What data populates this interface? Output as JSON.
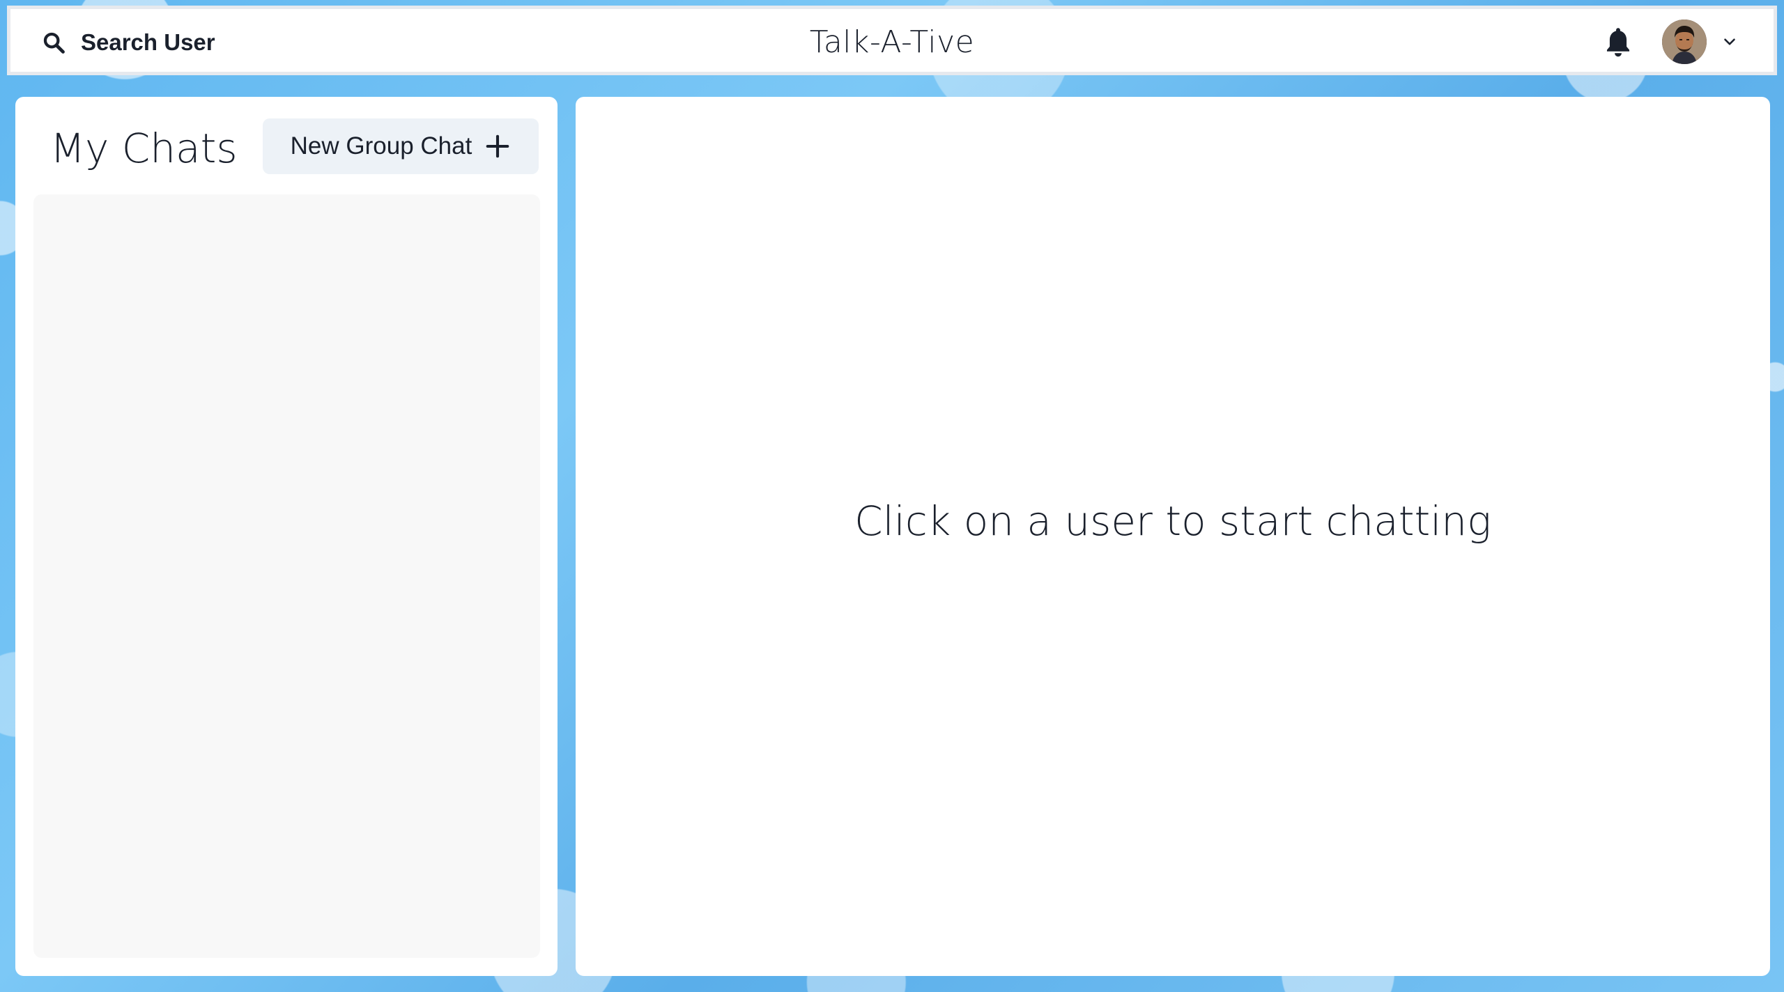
{
  "header": {
    "search_label": "Search User",
    "app_title": "Talk-A-Tive",
    "icons": {
      "search": "search-icon",
      "notifications": "bell-icon",
      "profile_menu": "chevron-down-icon"
    }
  },
  "sidebar": {
    "title": "My Chats",
    "new_group_label": "New Group Chat",
    "new_group_icon": "plus-icon",
    "chats": []
  },
  "chat_area": {
    "placeholder": "Click on a user to start chatting"
  },
  "colors": {
    "background_accent": "#5fb6f0",
    "panel": "#ffffff",
    "chat_list_bg": "#f8f8f8",
    "button_bg": "#edf2f7",
    "text": "#1a202c"
  }
}
